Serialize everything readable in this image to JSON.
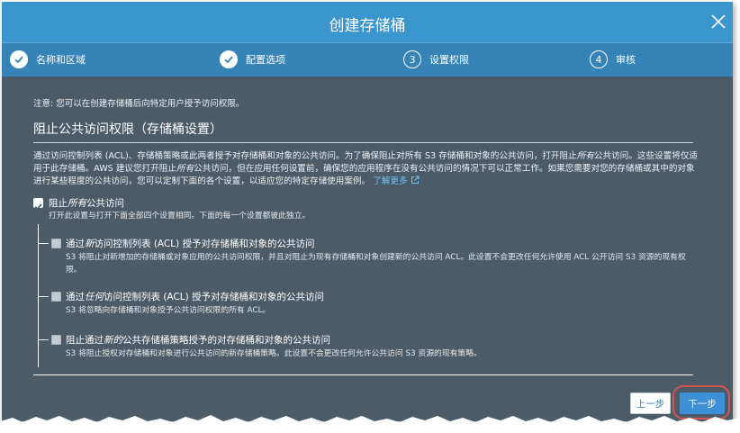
{
  "dialog": {
    "title": "创建存储桶",
    "close_icon": "close-icon"
  },
  "steps": [
    {
      "label": "名称和区域",
      "state": "done",
      "icon": "check-icon"
    },
    {
      "label": "配置选项",
      "state": "done",
      "icon": "check-icon"
    },
    {
      "label": "设置权限",
      "state": "current",
      "number": "3"
    },
    {
      "label": "审核",
      "state": "pending",
      "number": "4"
    }
  ],
  "content": {
    "notice": "注意: 您可以在创建存储桶后向特定用户授予访问权限。",
    "heading": "阻止公共访问权限（存储桶设置）",
    "description": {
      "part1": "通过访问控制列表 (ACL)、存储桶策略或此两者授予对存储桶和对象的公共访问。为了确保阻止对所有 S3 存储桶和对象的公共访问，打开阻止",
      "em1": "所有",
      "part2": "公共访问。这些设置将仅适用于此存储桶。AWS 建议您打开阻止",
      "em2": "所有",
      "part3": "公共访问，但在应用任何设置前，确保您的应用程序在没有公共访问的情况下可以正常工作。如果您需要对您的存储桶或其中的对象进行某些程度的公共访问，您可以定制下面的各个设置，以适应您的特定存储使用案例。",
      "learn_more": "了解更多"
    },
    "block_all": {
      "label_prefix": "阻止",
      "label_em": "所有",
      "label_suffix": "公共访问",
      "checked": true,
      "desc": "打开此设置与打开下面全部四个设置相同。下面的每一个设置都彼此独立。"
    },
    "options": [
      {
        "title_prefix": "通过",
        "title_em": "新",
        "title_suffix": "访问控制列表 (ACL) 授予对存储桶和对象的公共访问",
        "desc": "S3 将阻止对新增加的存储桶或对象应用的公共访问权限，并且对阻止为现有存储桶和对象创建新的公共访问 ACL。此设置不会更改任何允许使用 ACL 公开访问 S3 资源的现有权限。",
        "checked": true,
        "disabled": true
      },
      {
        "title_prefix": "通过",
        "title_em": "任何",
        "title_suffix": "访问控制列表 (ACL) 授予对存储桶和对象的公共访问",
        "desc": "S3 将忽略向存储桶和对象授予公共访问权限的所有 ACL。",
        "checked": true,
        "disabled": true
      },
      {
        "title_prefix": "阻止通过",
        "title_em": "新的",
        "title_suffix": "公共存储桶策略授予的对存储桶和对象的公共访问",
        "desc": "S3 将阻止授权对存储桶和对象进行公共访问的新存储桶策略。此设置不会更改任何允许公共访问 S3 资源的现有策略。",
        "checked": true,
        "disabled": true
      }
    ]
  },
  "footer": {
    "prev_label": "上一步",
    "next_label": "下一步"
  },
  "colors": {
    "title_bar": "#3c96ce",
    "steps_bar": "#3583b7",
    "panel": "#4b5c68",
    "primary_button": "#3d8fd6",
    "highlight": "#d9534f",
    "link": "#6fc3f5"
  }
}
